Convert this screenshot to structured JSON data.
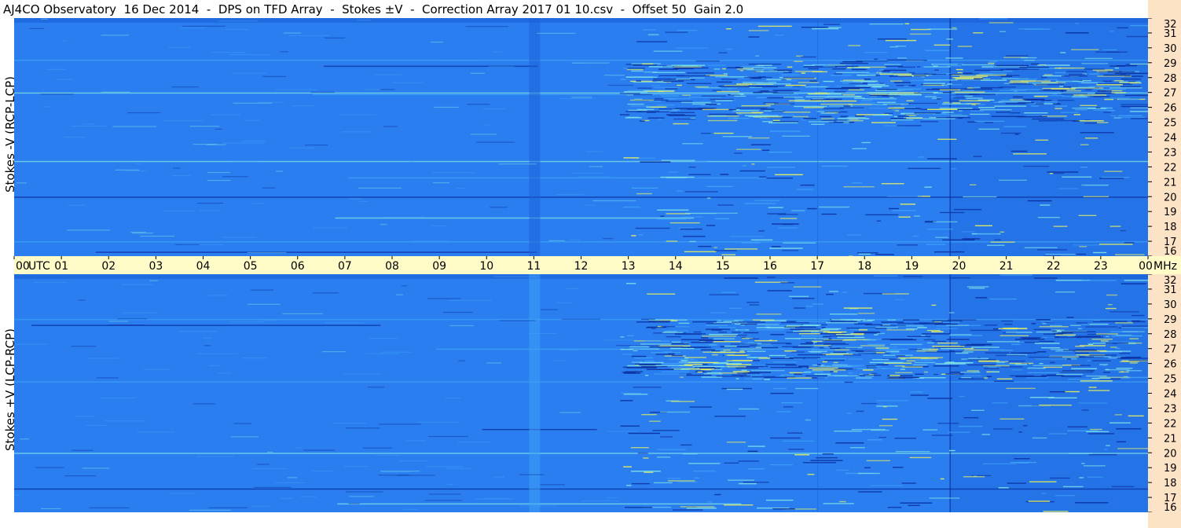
{
  "title": "AJ4CO Observatory  16 Dec 2014  -  DPS on TFD Array  -  Stokes ±V  -  Correction Array 2017 01 10.csv  -  Offset 50  Gain 2.0",
  "chart_data": [
    {
      "type": "heatmap",
      "name": "panel-top",
      "ylabel": "Stokes -V (RCP-LCP)",
      "x_ticks": [
        "00",
        "01",
        "02",
        "03",
        "04",
        "05",
        "06",
        "07",
        "08",
        "09",
        "10",
        "11",
        "12",
        "13",
        "14",
        "15",
        "16",
        "17",
        "18",
        "19",
        "20",
        "21",
        "22",
        "23",
        "00"
      ],
      "x_range": [
        0,
        24
      ],
      "y_ticks": [
        "16",
        "17",
        "18",
        "19",
        "20",
        "21",
        "22",
        "23",
        "24",
        "25",
        "26",
        "27",
        "28",
        "29",
        "30",
        "31",
        "32"
      ],
      "y_range": [
        16,
        32
      ],
      "colormap": [
        "#0b2f9e",
        "#1a5fd6",
        "#2a7ef0",
        "#3fa2f6",
        "#7fe3e6",
        "#e8f060"
      ],
      "active_region_start_utc": 12.8
    },
    {
      "type": "heatmap",
      "name": "panel-bottom",
      "ylabel": "Stokes +V (LCP-RCP)",
      "x_ticks": [
        "00",
        "01",
        "02",
        "03",
        "04",
        "05",
        "06",
        "07",
        "08",
        "09",
        "10",
        "11",
        "12",
        "13",
        "14",
        "15",
        "16",
        "17",
        "18",
        "19",
        "20",
        "21",
        "22",
        "23",
        "00"
      ],
      "x_range": [
        0,
        24
      ],
      "y_ticks": [
        "16",
        "17",
        "18",
        "19",
        "20",
        "21",
        "22",
        "23",
        "24",
        "25",
        "26",
        "27",
        "28",
        "29",
        "30",
        "31",
        "32"
      ],
      "y_range": [
        16,
        32
      ],
      "colormap": [
        "#0b2f9e",
        "#1a5fd6",
        "#2a7ef0",
        "#3fa2f6",
        "#7fe3e6",
        "#e8f060"
      ],
      "active_region_start_utc": 12.8
    }
  ],
  "time_axis": {
    "labels": [
      "00",
      "01",
      "02",
      "03",
      "04",
      "05",
      "06",
      "07",
      "08",
      "09",
      "10",
      "11",
      "12",
      "13",
      "14",
      "15",
      "16",
      "17",
      "18",
      "19",
      "20",
      "21",
      "22",
      "23",
      "00"
    ],
    "start_label_suffix": "UTC",
    "end_label_suffix": "MHz"
  },
  "colors": {
    "background": "#ffffff",
    "time_strip": "#fffcc8",
    "freq_strip": "#fde3c6",
    "base_blue": "#2a7ef0"
  }
}
